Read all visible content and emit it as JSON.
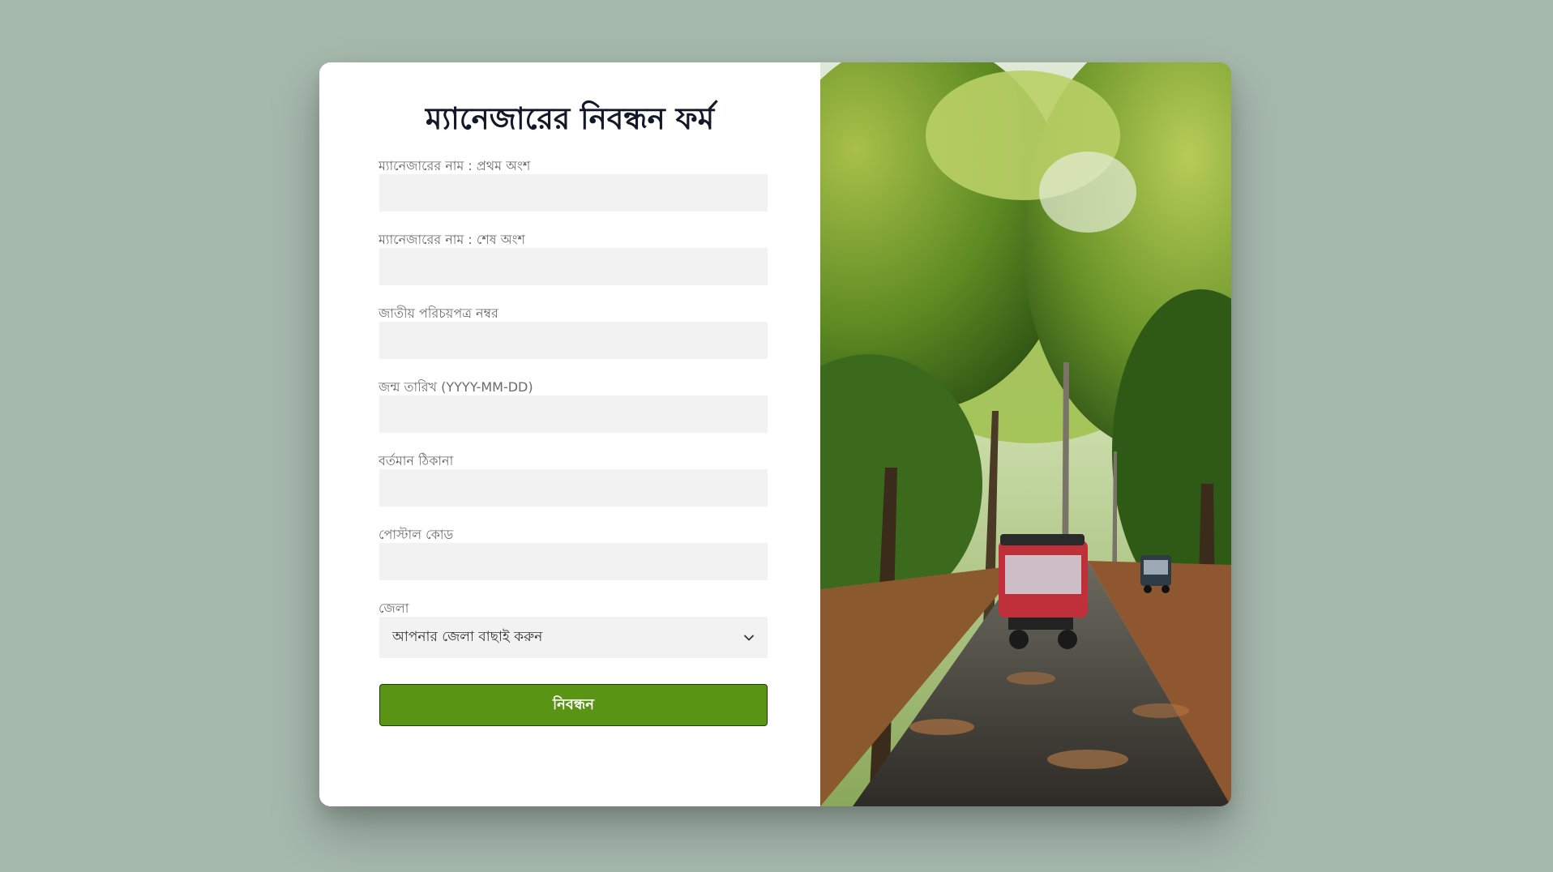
{
  "form": {
    "title": "ম্যানেজারের নিবন্ধন ফর্ম",
    "fields": [
      {
        "label": "ম্যানেজারের নাম : প্রথম অংশ",
        "value": "",
        "placeholder": ""
      },
      {
        "label": "ম্যানেজারের নাম : শেষ অংশ",
        "value": "",
        "placeholder": ""
      },
      {
        "label": "জাতীয় পরিচয়পত্র নম্বর",
        "value": "",
        "placeholder": ""
      },
      {
        "label": "জন্ম তারিখ (YYYY-MM-DD)",
        "value": "",
        "placeholder": ""
      },
      {
        "label": "বর্তমান ঠিকানা",
        "value": "",
        "placeholder": ""
      },
      {
        "label": "পোস্টাল কোড",
        "value": "",
        "placeholder": ""
      }
    ],
    "district": {
      "label": "জেলা",
      "selected": "আপনার জেলা বাছাই করুন",
      "icon": "chevron-down-icon"
    },
    "submit_label": "নিবন্ধন"
  },
  "image": {
    "description_icon": "tree-lined-road-photo"
  },
  "colors": {
    "background": "#a6b9ad",
    "card": "#ffffff",
    "input_bg": "#f2f2f2",
    "button": "#5a9414",
    "button_border": "#1f3d05",
    "title": "#111827",
    "label": "#6b6b6b"
  }
}
